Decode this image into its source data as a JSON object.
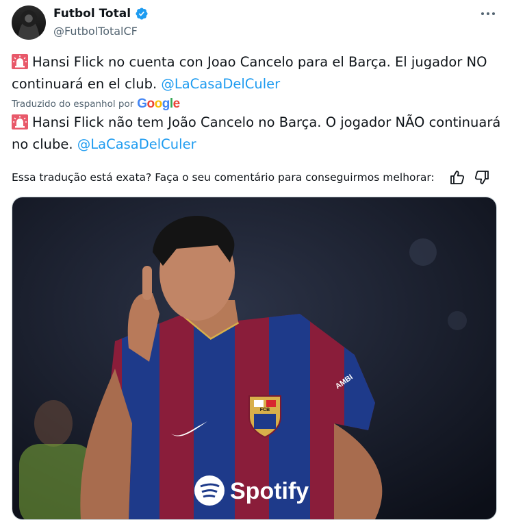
{
  "author": {
    "display_name": "Futbol Total",
    "handle": "@FutbolTotalCF",
    "verified": true
  },
  "original_text": {
    "emoji": "siren-icon",
    "body": "Hansi Flick no cuenta con Joao Cancelo para el Barça. El jugador NO continuará en el club.",
    "mention": "@LaCasaDelCuler"
  },
  "translation": {
    "label": "Traduzido do espanhol por",
    "provider": "Google",
    "emoji": "siren-icon",
    "body": "Hansi Flick não tem João Cancelo no Barça. O jogador NÃO continuará no clube.",
    "mention": "@LaCasaDelCuler"
  },
  "feedback": {
    "question": "Essa tradução está exata? Faça o seu comentário para conseguirmos melhorar:"
  },
  "media": {
    "sponsor": "Spotify",
    "sleeve_text": "AMBI",
    "crest_text": "FCB"
  },
  "colors": {
    "accent": "#1d9bf0",
    "muted": "#536471",
    "text": "#0f1419"
  }
}
